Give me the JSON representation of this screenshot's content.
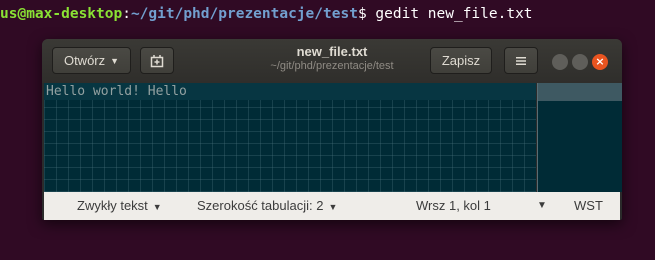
{
  "terminal": {
    "user_host": "us@max-desktop",
    "separator": ":",
    "path": "~/git/phd/prezentacje/test",
    "prompt_and_command": "$ gedit new_file.txt"
  },
  "window": {
    "open_button_label": "Otwórz",
    "title": "new_file.txt",
    "subtitle": "~/git/phd/prezentacje/test",
    "save_button_label": "Zapisz",
    "close_glyph": "×"
  },
  "editor": {
    "content": "Hello world! Hello"
  },
  "statusbar": {
    "language": "Zwykły tekst",
    "tab_width": "Szerokość tabulacji: 2",
    "cursor_position": "Wrsz 1, kol 1",
    "insert_mode": "WST"
  },
  "colors": {
    "terminal_bg": "#300a24",
    "editor_bg": "#002b36",
    "accent_close": "#e95420"
  }
}
